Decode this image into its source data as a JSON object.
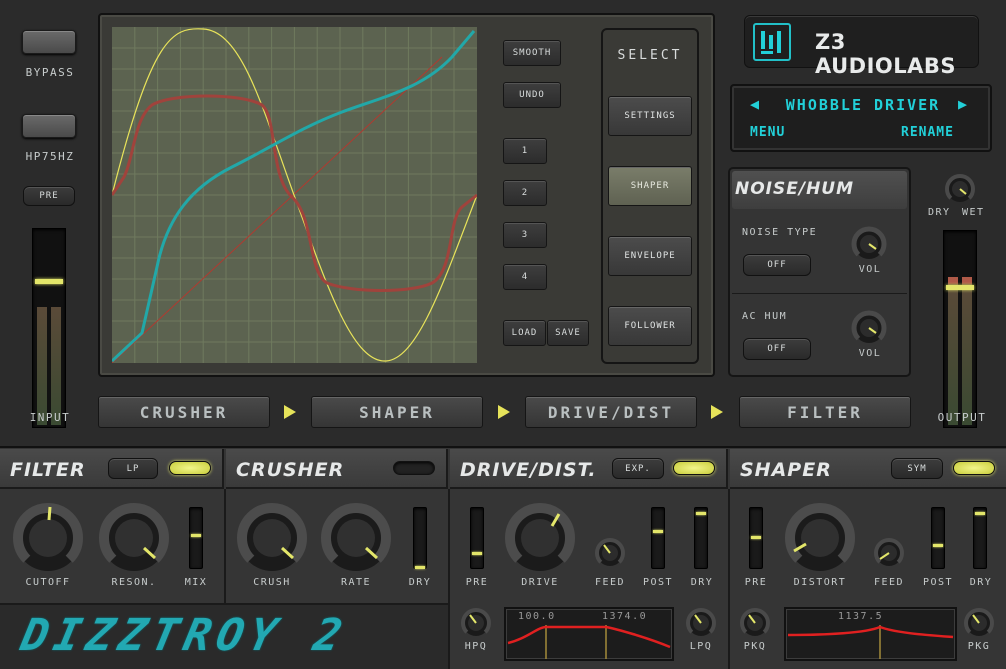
{
  "left_panel": {
    "bypass_label": "BYPASS",
    "hp_label": "HP75HZ",
    "pre_label": "PRE",
    "input_label": "INPUT"
  },
  "graph_controls": {
    "smooth": "SMOOTH",
    "undo": "UNDO",
    "presets": [
      "1",
      "2",
      "3",
      "4"
    ],
    "load": "LOAD",
    "save": "SAVE"
  },
  "select_panel": {
    "title": "SELECT",
    "buttons": [
      "SETTINGS",
      "SHAPER",
      "ENVELOPE",
      "FOLLOWER"
    ],
    "active": "SHAPER"
  },
  "brand": {
    "name": "Z3 AUDIOLABS"
  },
  "preset": {
    "name": "WHOBBLE DRIVER",
    "menu": "MENU",
    "rename": "RENAME"
  },
  "noise_hum": {
    "title": "NOISE/HUM",
    "noise_type_label": "NOISE TYPE",
    "noise_type_value": "OFF",
    "noise_vol_label": "VOL",
    "ac_hum_label": "AC HUM",
    "ac_hum_value": "OFF",
    "hum_vol_label": "VOL"
  },
  "output_panel": {
    "dry_label": "DRY",
    "wet_label": "WET",
    "output_label": "OUTPUT"
  },
  "chain": [
    "CRUSHER",
    "SHAPER",
    "DRIVE/DIST",
    "FILTER"
  ],
  "filter": {
    "title": "FILTER",
    "mode": "LP",
    "enabled": true,
    "knobs": [
      "CUTOFF",
      "RESON."
    ],
    "fader": "MIX"
  },
  "crusher": {
    "title": "CRUSHER",
    "enabled": false,
    "knobs": [
      "CRUSH",
      "RATE"
    ],
    "fader": "DRY"
  },
  "drive": {
    "title": "DRIVE/DIST.",
    "mode": "EXP.",
    "enabled": true,
    "labels": [
      "PRE",
      "DRIVE",
      "FEED",
      "POST",
      "DRY"
    ],
    "hpq_label": "HPQ",
    "lpq_label": "LPQ",
    "eq_low": "100.0",
    "eq_high": "1374.0"
  },
  "shaper": {
    "title": "SHAPER",
    "mode": "SYM",
    "enabled": true,
    "labels": [
      "PRE",
      "DISTORT",
      "FEED",
      "POST",
      "DRY"
    ],
    "pkq_label": "PKQ",
    "pkg_label": "PKG",
    "eq_freq": "1137.5"
  },
  "product": {
    "logo_text": "DIZZTROY 2"
  },
  "colors": {
    "accent_yellow": "#e3e66a",
    "accent_teal": "#22c0c8",
    "curve_red": "#a0433c",
    "eq_red": "#e02020"
  }
}
